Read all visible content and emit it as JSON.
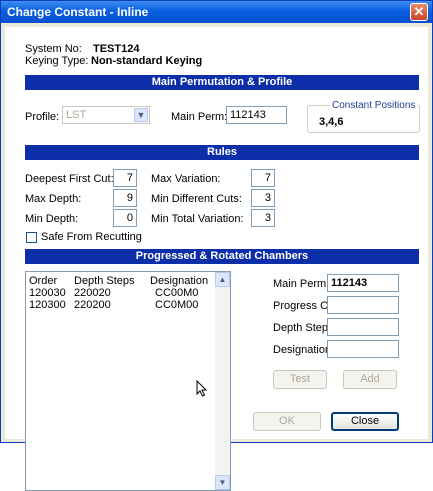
{
  "window": {
    "title": "Change Constant - Inline",
    "close_glyph": "✕"
  },
  "system": {
    "no_label": "System No:",
    "no_value": "TEST124",
    "keying_label": "Keying Type:",
    "keying_value": "Non-standard Keying"
  },
  "main_perm_section": {
    "title": "Main Permutation & Profile",
    "profile_label": "Profile:",
    "profile_value": "LST",
    "main_perm_label": "Main Perm:",
    "main_perm_value": "112143",
    "constant_positions_label": "Constant Positions",
    "constant_positions_value": "3,4,6"
  },
  "rules": {
    "title": "Rules",
    "deepest_first_cut_label": "Deepest First Cut:",
    "deepest_first_cut_value": "7",
    "max_depth_label": "Max Depth:",
    "max_depth_value": "9",
    "min_depth_label": "Min Depth:",
    "min_depth_value": "0",
    "max_variation_label": "Max Variation:",
    "max_variation_value": "7",
    "min_different_cuts_label": "Min Different Cuts:",
    "min_different_cuts_value": "3",
    "min_total_variation_label": "Min Total Variation:",
    "min_total_variation_value": "3",
    "safe_from_recutting_label": "Safe From Recutting",
    "safe_from_recutting_checked": false
  },
  "chambers": {
    "title": "Progressed & Rotated Chambers",
    "columns": [
      "Order",
      "Depth Steps",
      "Designation"
    ],
    "rows": [
      [
        "120030",
        "220020",
        "CC00M0"
      ],
      [
        "120300",
        "220200",
        "CC0M00"
      ]
    ],
    "main_perm_label": "Main Perm:",
    "main_perm_value": "112143",
    "progress_order_label": "Progress Order:",
    "progress_order_value": "",
    "depth_steps_label": "Depth Steps:",
    "depth_steps_value": "",
    "designation_label": "Designation:",
    "designation_value": "",
    "test_label": "Test",
    "add_label": "Add"
  },
  "footer": {
    "ok_label": "OK",
    "close_label": "Close"
  }
}
